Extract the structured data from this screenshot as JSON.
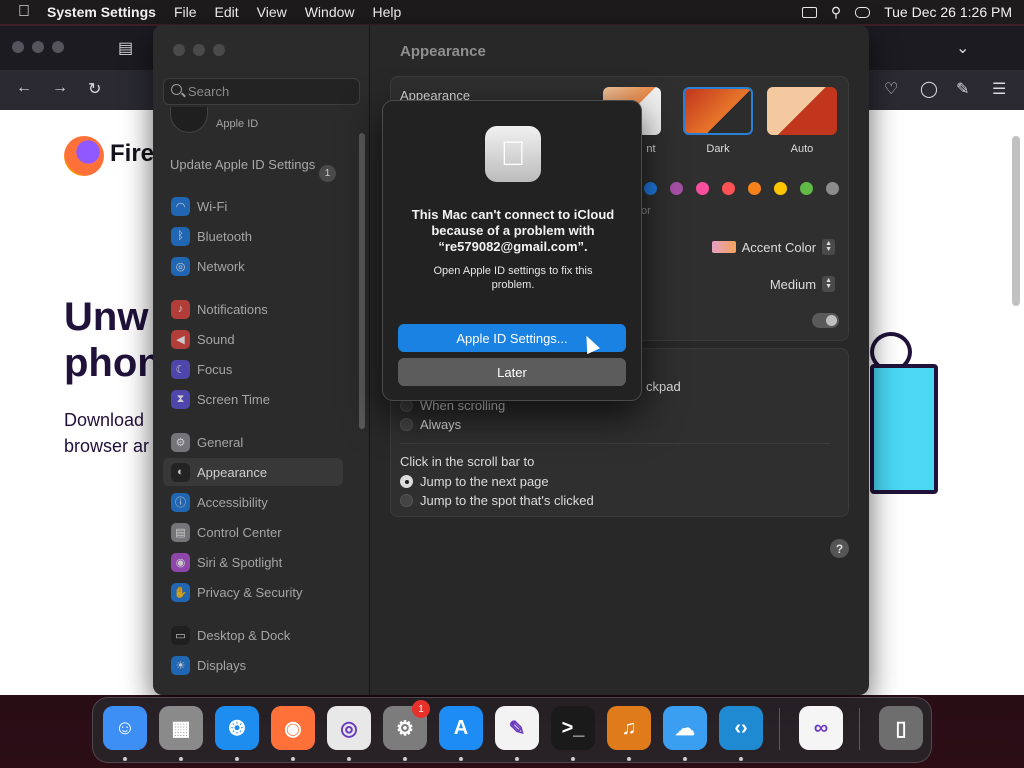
{
  "menubar": {
    "app": "System Settings",
    "items": [
      "File",
      "Edit",
      "View",
      "Window",
      "Help"
    ],
    "clock": "Tue Dec 26  1:26 PM",
    "icons": [
      "apple-icon",
      "screen-mirror-icon",
      "spotlight-search-icon",
      "control-center-icon"
    ]
  },
  "firefox": {
    "brand": "Fire",
    "headline": "Unw phon",
    "body": "Download browser ar"
  },
  "settings": {
    "search_placeholder": "Search",
    "apple_id_label": "Apple ID",
    "update_item": "Update Apple ID Settings",
    "update_badge": "1",
    "sidebar": [
      {
        "label": "Wi-Fi",
        "icon": "wifi-icon",
        "color": "#1e7ae0"
      },
      {
        "label": "Bluetooth",
        "icon": "bluetooth-icon",
        "color": "#1e7ae0"
      },
      {
        "label": "Network",
        "icon": "globe-icon",
        "color": "#1e7ae0"
      },
      {
        "label": "Notifications",
        "icon": "bell-icon",
        "color": "#e0443e"
      },
      {
        "label": "Sound",
        "icon": "speaker-icon",
        "color": "#e0443e"
      },
      {
        "label": "Focus",
        "icon": "moon-icon",
        "color": "#5b4fd6"
      },
      {
        "label": "Screen Time",
        "icon": "hourglass-icon",
        "color": "#5b4fd6"
      },
      {
        "label": "General",
        "icon": "gear-icon",
        "color": "#8e8e93"
      },
      {
        "label": "Appearance",
        "icon": "appearance-icon",
        "color": "#1c1c1c"
      },
      {
        "label": "Accessibility",
        "icon": "accessibility-icon",
        "color": "#1e7ae0"
      },
      {
        "label": "Control Center",
        "icon": "control-center-icon",
        "color": "#8e8e93"
      },
      {
        "label": "Siri & Spotlight",
        "icon": "siri-icon",
        "color": "#b04fd6"
      },
      {
        "label": "Privacy & Security",
        "icon": "hand-icon",
        "color": "#1e7ae0"
      },
      {
        "label": "Desktop & Dock",
        "icon": "dock-icon",
        "color": "#1c1c1c"
      },
      {
        "label": "Displays",
        "icon": "sun-icon",
        "color": "#1e7ae0"
      }
    ],
    "selected": "Appearance",
    "main": {
      "title": "Appearance",
      "appearance_label": "Appearance",
      "themes": [
        "Light",
        "Dark",
        "Auto"
      ],
      "theme_labels_visible": {
        "light_partial": "nt",
        "dark": "Dark",
        "auto": "Auto"
      },
      "selected_theme": "Dark",
      "accent_colors": [
        "#1f7ae0",
        "#a550a7",
        "#f74f9e",
        "#ff5257",
        "#f7821b",
        "#ffc600",
        "#62ba46",
        "#8c8c8c"
      ],
      "accent_partial": "or",
      "accent_color_label": "Accent Color",
      "sidebar_size_value": "Medium",
      "trackpad_partial": "ckpad",
      "scroll_options": [
        "When scrolling",
        "Always"
      ],
      "click_label": "Click in the scroll bar to",
      "click_options": [
        "Jump to the next page",
        "Jump to the spot that's clicked"
      ],
      "help": "?"
    }
  },
  "alert": {
    "title": "This Mac can't connect to iCloud because of a problem with “re579082@gmail.com”.",
    "message": "Open Apple ID settings to fix this problem.",
    "primary": "Apple ID Settings...",
    "secondary": "Later"
  },
  "dock": {
    "apps": [
      "Finder",
      "Launchpad",
      "Safari",
      "Firefox",
      "Chrome",
      "System Settings",
      "App Store",
      "TextEdit",
      "Terminal",
      "GarageBand",
      "Weather",
      "Visual Studio Code",
      "Visual Studio",
      "Trash"
    ],
    "settings_badge": "1"
  }
}
